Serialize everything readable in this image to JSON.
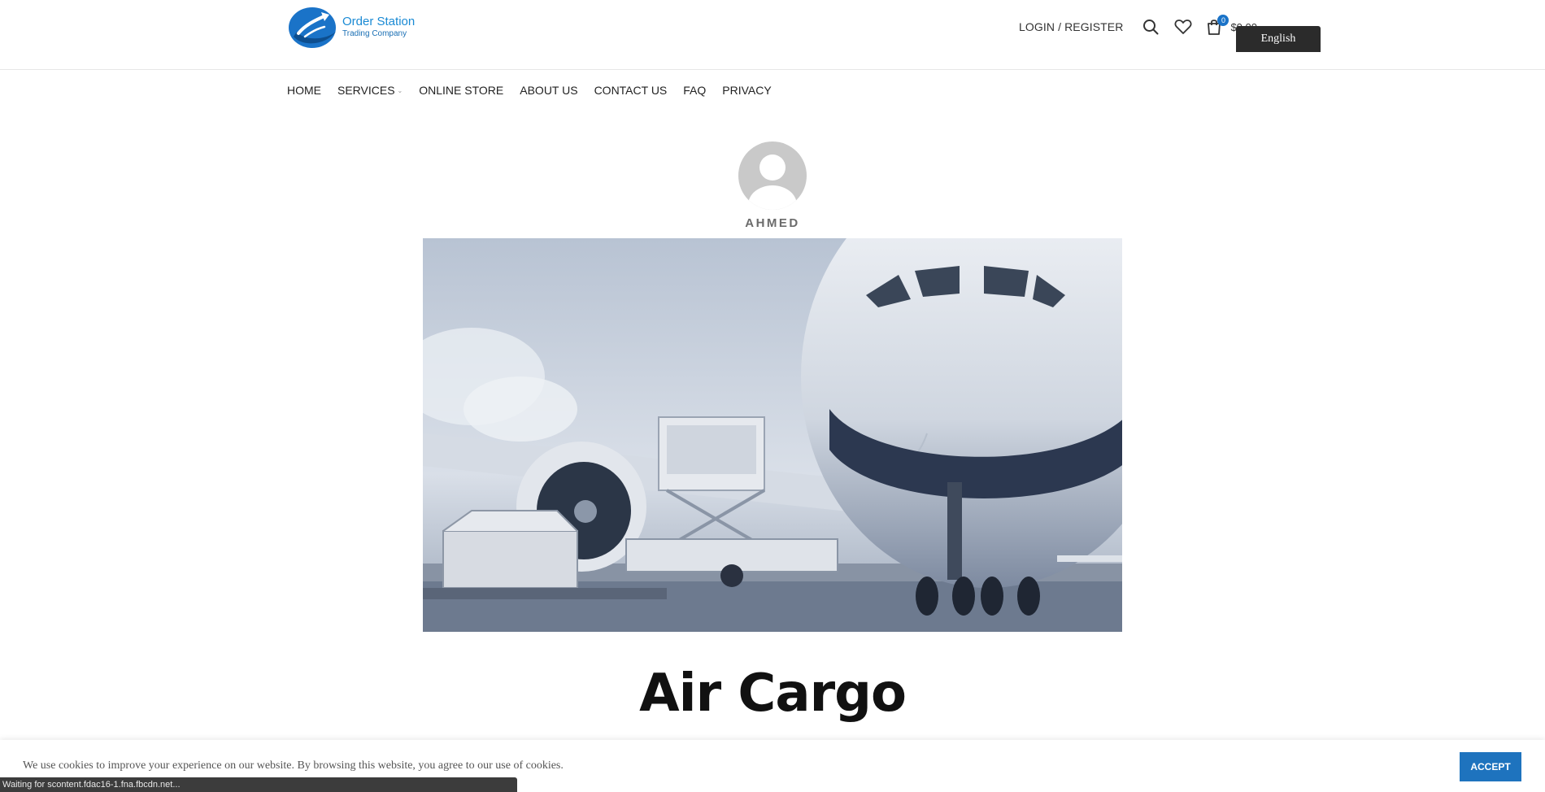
{
  "header": {
    "logo_title": "Order Station",
    "logo_subtitle": "Trading Company",
    "login_label": "LOGIN / REGISTER",
    "cart_count": "0",
    "cart_total": "$0.00"
  },
  "nav": {
    "items": [
      {
        "label": "HOME"
      },
      {
        "label": "SERVICES",
        "has_dropdown": true
      },
      {
        "label": "ONLINE STORE"
      },
      {
        "label": "ABOUT US"
      },
      {
        "label": "CONTACT US"
      },
      {
        "label": "FAQ"
      },
      {
        "label": "PRIVACY"
      }
    ]
  },
  "post": {
    "author": "AHMED",
    "title": "Air Cargo",
    "image_icon": "air-cargo-photo"
  },
  "cookie": {
    "text": "We use cookies to improve your experience on our website. By browsing this website, you agree to our use of cookies.",
    "accept_label": "ACCEPT"
  },
  "language": {
    "selected": "English"
  },
  "browser_status": "Waiting for scontent.fdac16-1.fna.fbcdn.net...",
  "colors": {
    "accent": "#1e73be",
    "logo": "#1a8ad4",
    "badge": "#1a73c8"
  }
}
